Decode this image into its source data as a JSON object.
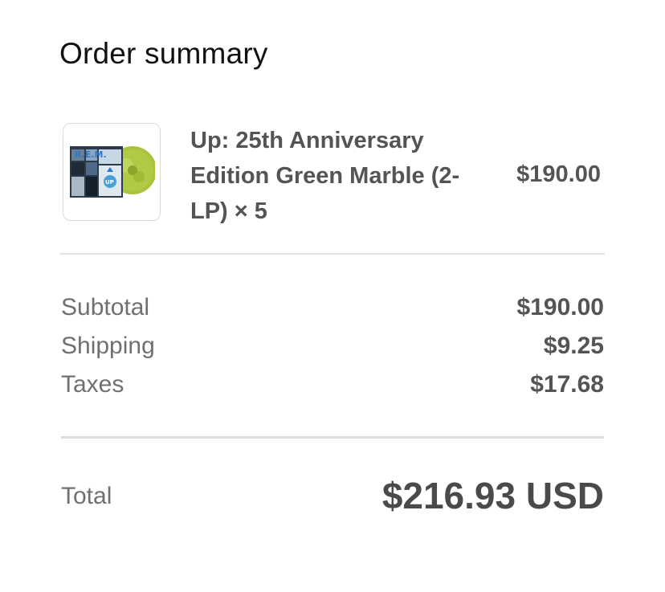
{
  "header": {
    "title": "Order summary"
  },
  "line_item": {
    "name": "Up: 25th Anniversary Edition Green Marble (2-LP) × 5",
    "price": "$190.00",
    "image_icon": "album-cover-icon",
    "cover_text": {
      "band": "R.E.M.",
      "badge": "UP"
    }
  },
  "summary": {
    "subtotal_label": "Subtotal",
    "subtotal_value": "$190.00",
    "shipping_label": "Shipping",
    "shipping_value": "$9.25",
    "taxes_label": "Taxes",
    "taxes_value": "$17.68"
  },
  "total": {
    "label": "Total",
    "value": "$216.93 USD"
  },
  "colors": {
    "text_primary": "#111111",
    "text_secondary": "#707073",
    "text_strong": "#545456",
    "divider": "#e3e3e3",
    "vinyl_green": "#a6c23a"
  }
}
